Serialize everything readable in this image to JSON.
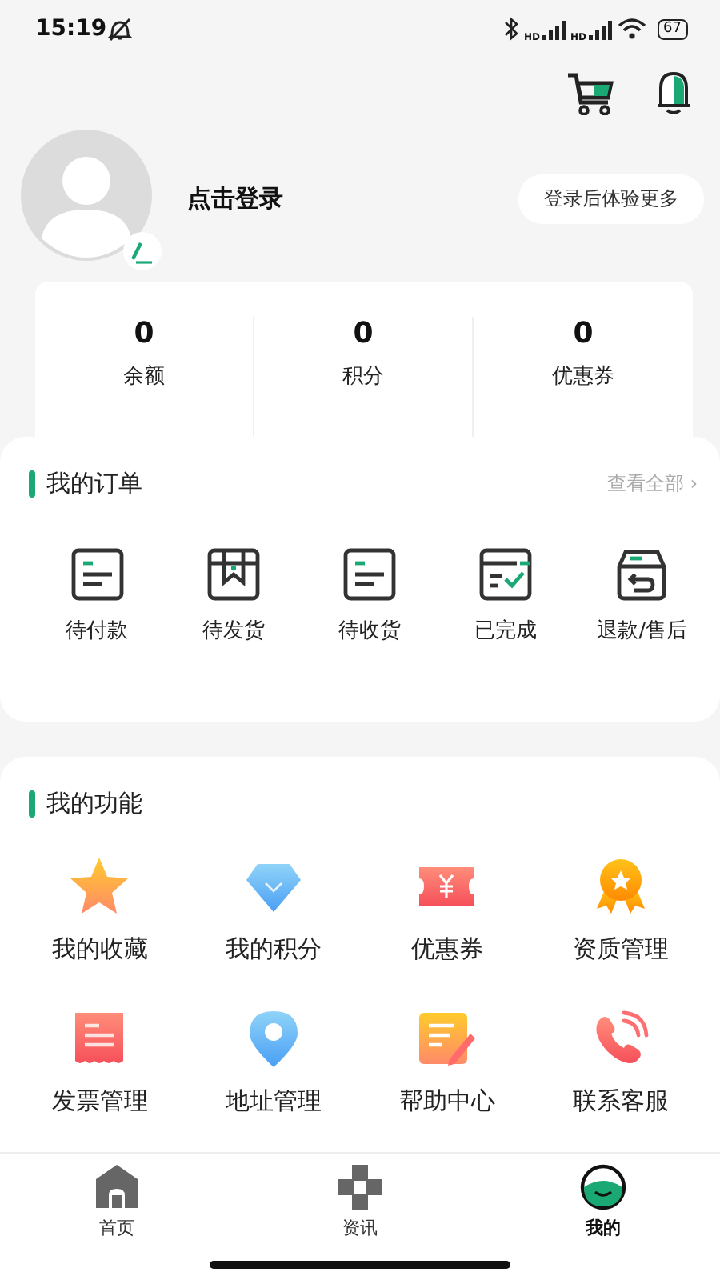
{
  "status_bar": {
    "time": "15:19",
    "signals": [
      {
        "label": "HD"
      },
      {
        "label": "HD"
      }
    ],
    "battery": "67"
  },
  "profile": {
    "login_text": "点击登录",
    "more_button": "登录后体验更多"
  },
  "stats": [
    {
      "value": "0",
      "label": "余额"
    },
    {
      "value": "0",
      "label": "积分"
    },
    {
      "value": "0",
      "label": "优惠券"
    }
  ],
  "orders": {
    "title": "我的订单",
    "view_all": "查看全部",
    "view_all_arrow": "›",
    "items": [
      {
        "label": "待付款"
      },
      {
        "label": "待发货"
      },
      {
        "label": "待收货"
      },
      {
        "label": "已完成"
      },
      {
        "label": "退款/售后"
      }
    ]
  },
  "features": {
    "title": "我的功能",
    "items": [
      {
        "label": "我的收藏"
      },
      {
        "label": "我的积分"
      },
      {
        "label": "优惠券"
      },
      {
        "label": "资质管理"
      },
      {
        "label": "发票管理"
      },
      {
        "label": "地址管理"
      },
      {
        "label": "帮助中心"
      },
      {
        "label": "联系客服"
      }
    ]
  },
  "tab_bar": [
    {
      "label": "首页",
      "selected": false
    },
    {
      "label": "资讯",
      "selected": false
    },
    {
      "label": "我的",
      "selected": true
    }
  ]
}
